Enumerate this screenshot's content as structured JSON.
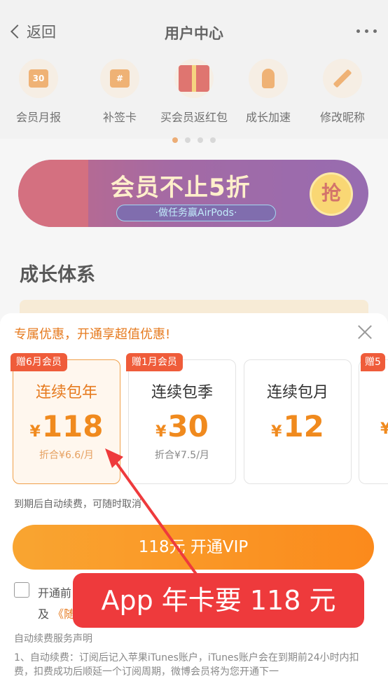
{
  "nav": {
    "back_label": "返回",
    "title": "用户中心"
  },
  "menu": [
    {
      "label": "会员月报",
      "icon": "calendar-icon",
      "glyph": "30"
    },
    {
      "label": "补签卡",
      "icon": "card-icon",
      "glyph": "#"
    },
    {
      "label": "买会员返红包",
      "icon": "gift-icon",
      "glyph": ""
    },
    {
      "label": "成长加速",
      "icon": "rocket-icon",
      "glyph": ""
    },
    {
      "label": "修改昵称",
      "icon": "pencil-icon",
      "glyph": ""
    }
  ],
  "carousel": {
    "pages": 4,
    "active": 0
  },
  "banner": {
    "title": "会员不止5折",
    "subtitle": "·做任务赢AirPods·",
    "button": "抢"
  },
  "section": {
    "title": "成长体系"
  },
  "sheet": {
    "headline": "专属优惠，开通享超值优惠!",
    "plans": [
      {
        "badge": "赠6月会员",
        "name": "连续包年",
        "currency": "¥",
        "price": "118",
        "per": "折合¥6.6/月",
        "selected": true
      },
      {
        "badge": "赠1月会员",
        "name": "连续包季",
        "currency": "¥",
        "price": "30",
        "per": "折合¥7.5/月",
        "selected": false
      },
      {
        "badge": "",
        "name": "连续包月",
        "currency": "¥",
        "price": "12",
        "per": "",
        "selected": false
      },
      {
        "badge": "赠5",
        "name": "",
        "currency": "¥",
        "price": "",
        "per": "",
        "selected": false
      }
    ],
    "renew_note": "到期后自动续费，可随时取消",
    "cta": "118元 开通VIP",
    "agree_line1": "开通前",
    "agree_line2_prefix": "及",
    "agree_line2_link": "《随",
    "declaration_title": "自动续费服务声明",
    "declaration_body": "1、自动续费：订阅后记入苹果iTunes账户，iTunes账户会在到期前24小时内扣费，扣费成功后顺延一个订阅周期，微博会员将为您开通下一"
  },
  "annotation": {
    "text": "App 年卡要 118 元"
  },
  "colors": {
    "accent": "#f08a1e",
    "cta": "#fb8a1c",
    "badge": "#ef5c3a",
    "annotation": "#ee3a3c"
  }
}
